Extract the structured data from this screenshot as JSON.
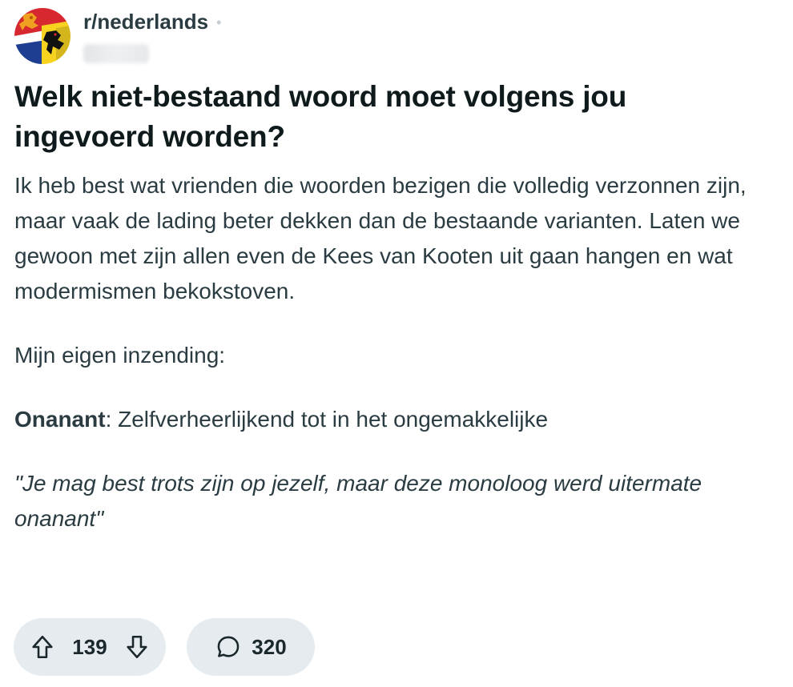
{
  "post": {
    "subreddit": "r/nederlands",
    "separator": "•",
    "title": "Welk niet-bestaand woord moet volgens jou ingevoerd worden?",
    "paragraphs": {
      "p1": "Ik heb best wat vrienden die woorden bezigen die volledig verzonnen zijn, maar vaak de lading beter dekken dan de bestaande varianten. Laten we gewoon met zijn allen even de Kees van Kooten uit gaan hangen en wat modermismen bekokstoven.",
      "p2": "Mijn eigen inzending:",
      "p3_term": "Onanant",
      "p3_rest": ": Zelfverheerlijkend tot in het ongemakkelijke",
      "p4": "\"Je mag best trots zijn op jezelf, maar deze monoloog werd uitermate onanant\""
    },
    "votes": "139",
    "comments": "320"
  },
  "icons": {
    "avatar": "subreddit-flag-lion-avatar",
    "upvote": "arrow-up-icon",
    "downvote": "arrow-down-icon",
    "comment": "speech-bubble-icon"
  },
  "colors": {
    "pill_bg": "#e5ebee",
    "text": "#2a3c42",
    "title": "#0f1a1c"
  }
}
